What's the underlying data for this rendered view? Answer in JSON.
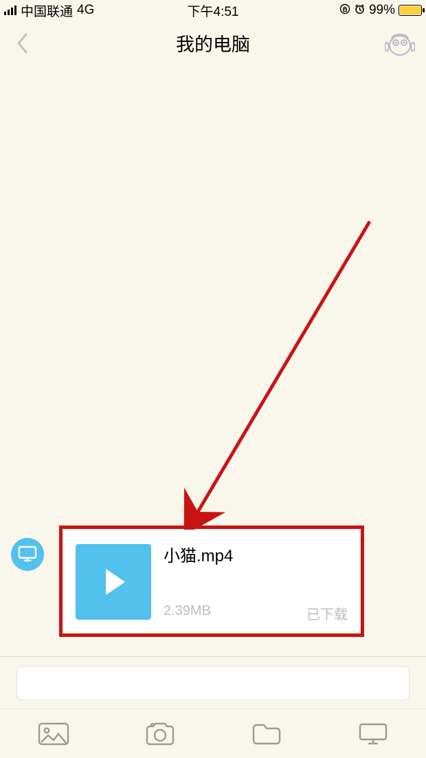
{
  "status_bar": {
    "carrier": "中国联通",
    "network": "4G",
    "time": "下午4:51",
    "battery_percent": "99%"
  },
  "nav": {
    "title": "我的电脑"
  },
  "message": {
    "file_name": "小猫.mp4",
    "file_size": "2.39MB",
    "download_state": "已下载"
  }
}
